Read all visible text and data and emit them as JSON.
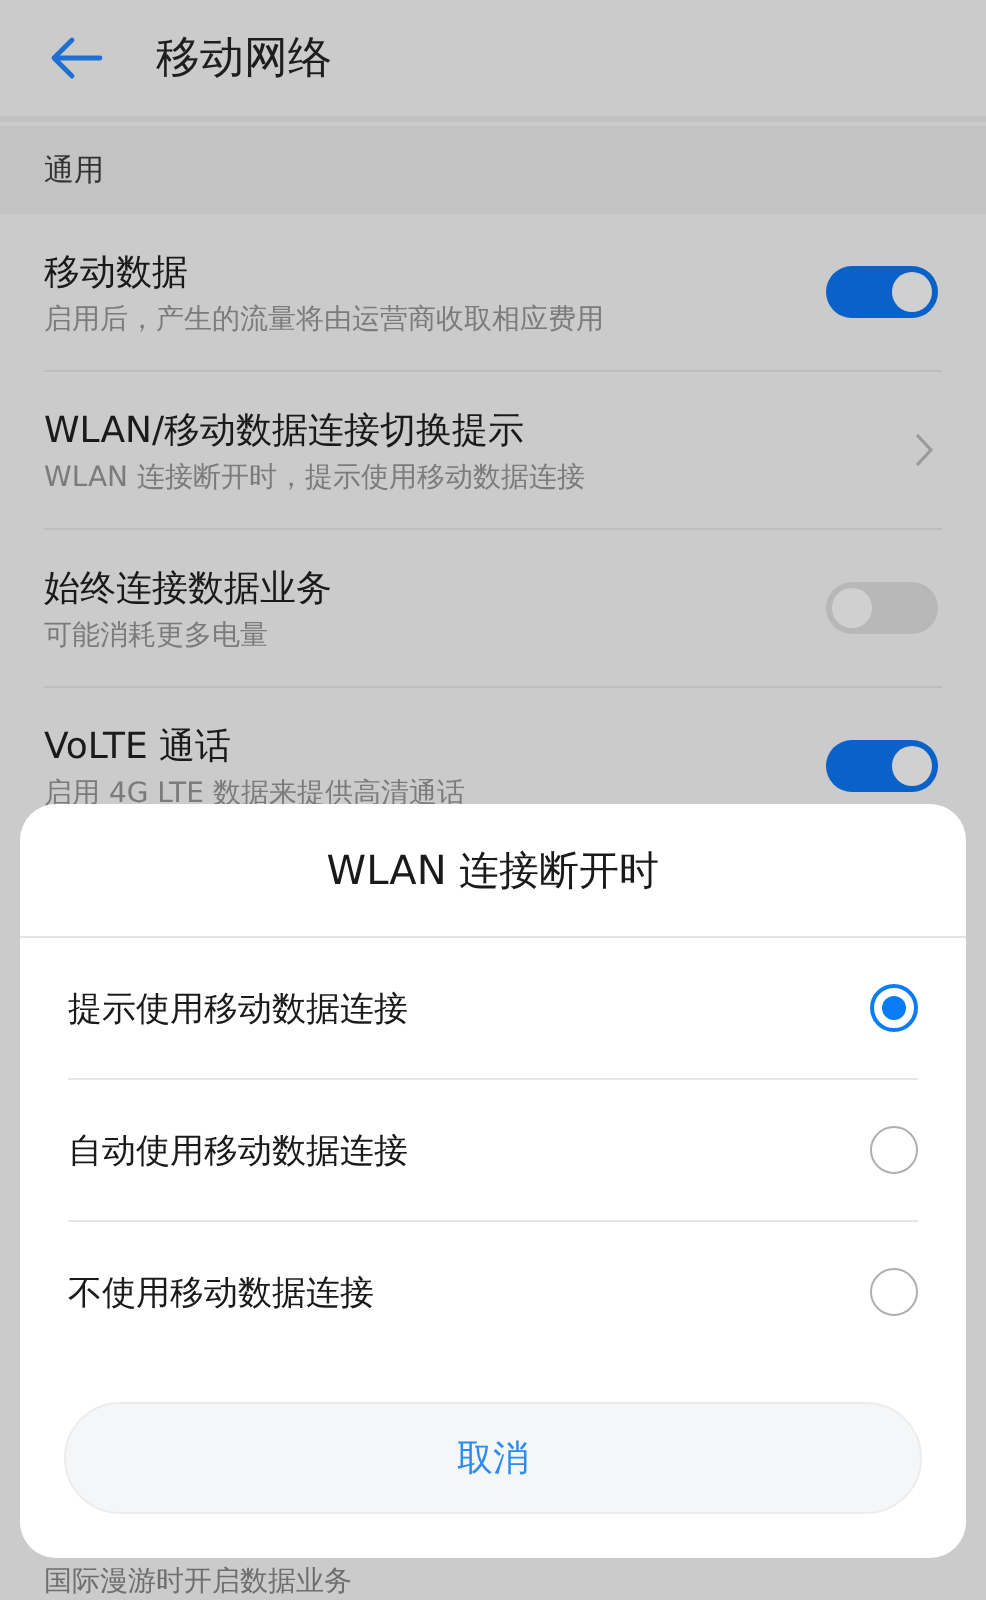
{
  "header": {
    "title": "移动网络"
  },
  "section": {
    "title": "通用"
  },
  "settings": [
    {
      "kind": "toggle",
      "title": "移动数据",
      "subtitle": "启用后，产生的流量将由运营商收取相应费用",
      "on": true
    },
    {
      "kind": "link",
      "title": "WLAN/移动数据连接切换提示",
      "subtitle": "WLAN 连接断开时，提示使用移动数据连接"
    },
    {
      "kind": "toggle",
      "title": "始终连接数据业务",
      "subtitle": "可能消耗更多电量",
      "on": false
    },
    {
      "kind": "toggle",
      "title": "VoLTE 通话",
      "subtitle": "启用 4G LTE 数据来提供高清通话",
      "on": true
    }
  ],
  "hidden_row": {
    "subtitle": "国际漫游时开启数据业务"
  },
  "dialog": {
    "title": "WLAN 连接断开时",
    "options": [
      {
        "label": "提示使用移动数据连接",
        "selected": true
      },
      {
        "label": "自动使用移动数据连接",
        "selected": false
      },
      {
        "label": "不使用移动数据连接",
        "selected": false
      }
    ],
    "cancel": "取消"
  }
}
